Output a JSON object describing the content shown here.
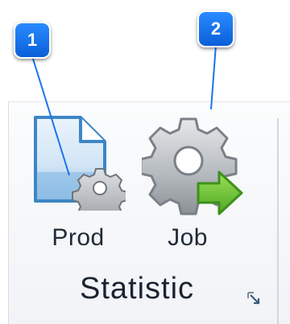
{
  "ribbon_group": {
    "label": "Statistic",
    "buttons": [
      {
        "label": "Prod",
        "icon": "production-report-gear-icon"
      },
      {
        "label": "Job",
        "icon": "job-gear-arrow-icon"
      }
    ],
    "launcher_icon": "dialog-launcher-icon"
  },
  "callouts": [
    {
      "number": "1",
      "target": "Prod"
    },
    {
      "number": "2",
      "target": "Job"
    }
  ],
  "colors": {
    "callout_blue": "#1a74ee",
    "document_blue": "#5aa0d8",
    "gear_gray": "#9aa0a6",
    "arrow_green": "#5cb82e"
  }
}
